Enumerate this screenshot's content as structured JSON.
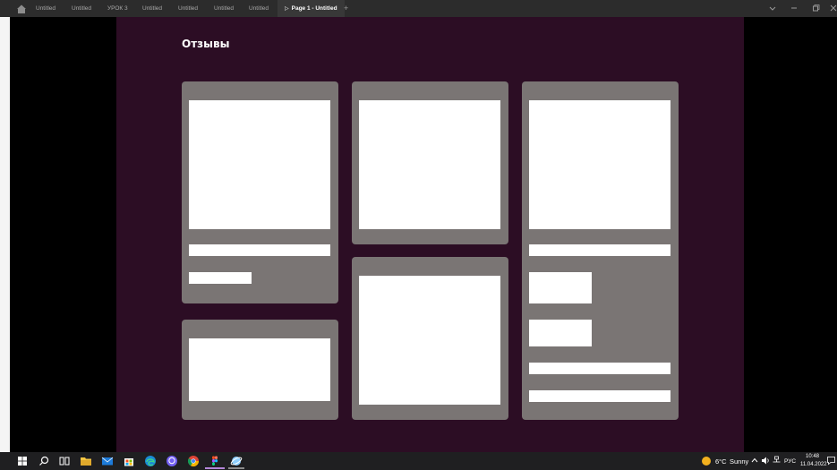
{
  "tabs": [
    {
      "label": "Untitled",
      "active": false
    },
    {
      "label": "Untitled",
      "active": false
    },
    {
      "label": "УРОК 3",
      "active": false
    },
    {
      "label": "Untitled",
      "active": false
    },
    {
      "label": "Untitled",
      "active": false
    },
    {
      "label": "Untitled",
      "active": false
    },
    {
      "label": "Untitled",
      "active": false
    },
    {
      "label": "Page 1 - Untitled",
      "active": true
    }
  ],
  "active_tab_icon": "play-icon",
  "new_tab_label": "+",
  "frame": {
    "title": "Отзывы",
    "background": "#2c0d24",
    "card_color": "#7a7574"
  },
  "taskbar": {
    "weather_temp": "6°C",
    "weather_desc": "Sunny",
    "language": "РУС",
    "time": "10:48",
    "date": "11.04.2022",
    "apps": [
      "start-icon",
      "search-icon",
      "task-view-icon",
      "file-explorer-icon",
      "mail-icon",
      "store-icon",
      "edge-icon",
      "viber-icon",
      "chrome-icon",
      "figma-icon",
      "browser-icon"
    ]
  }
}
